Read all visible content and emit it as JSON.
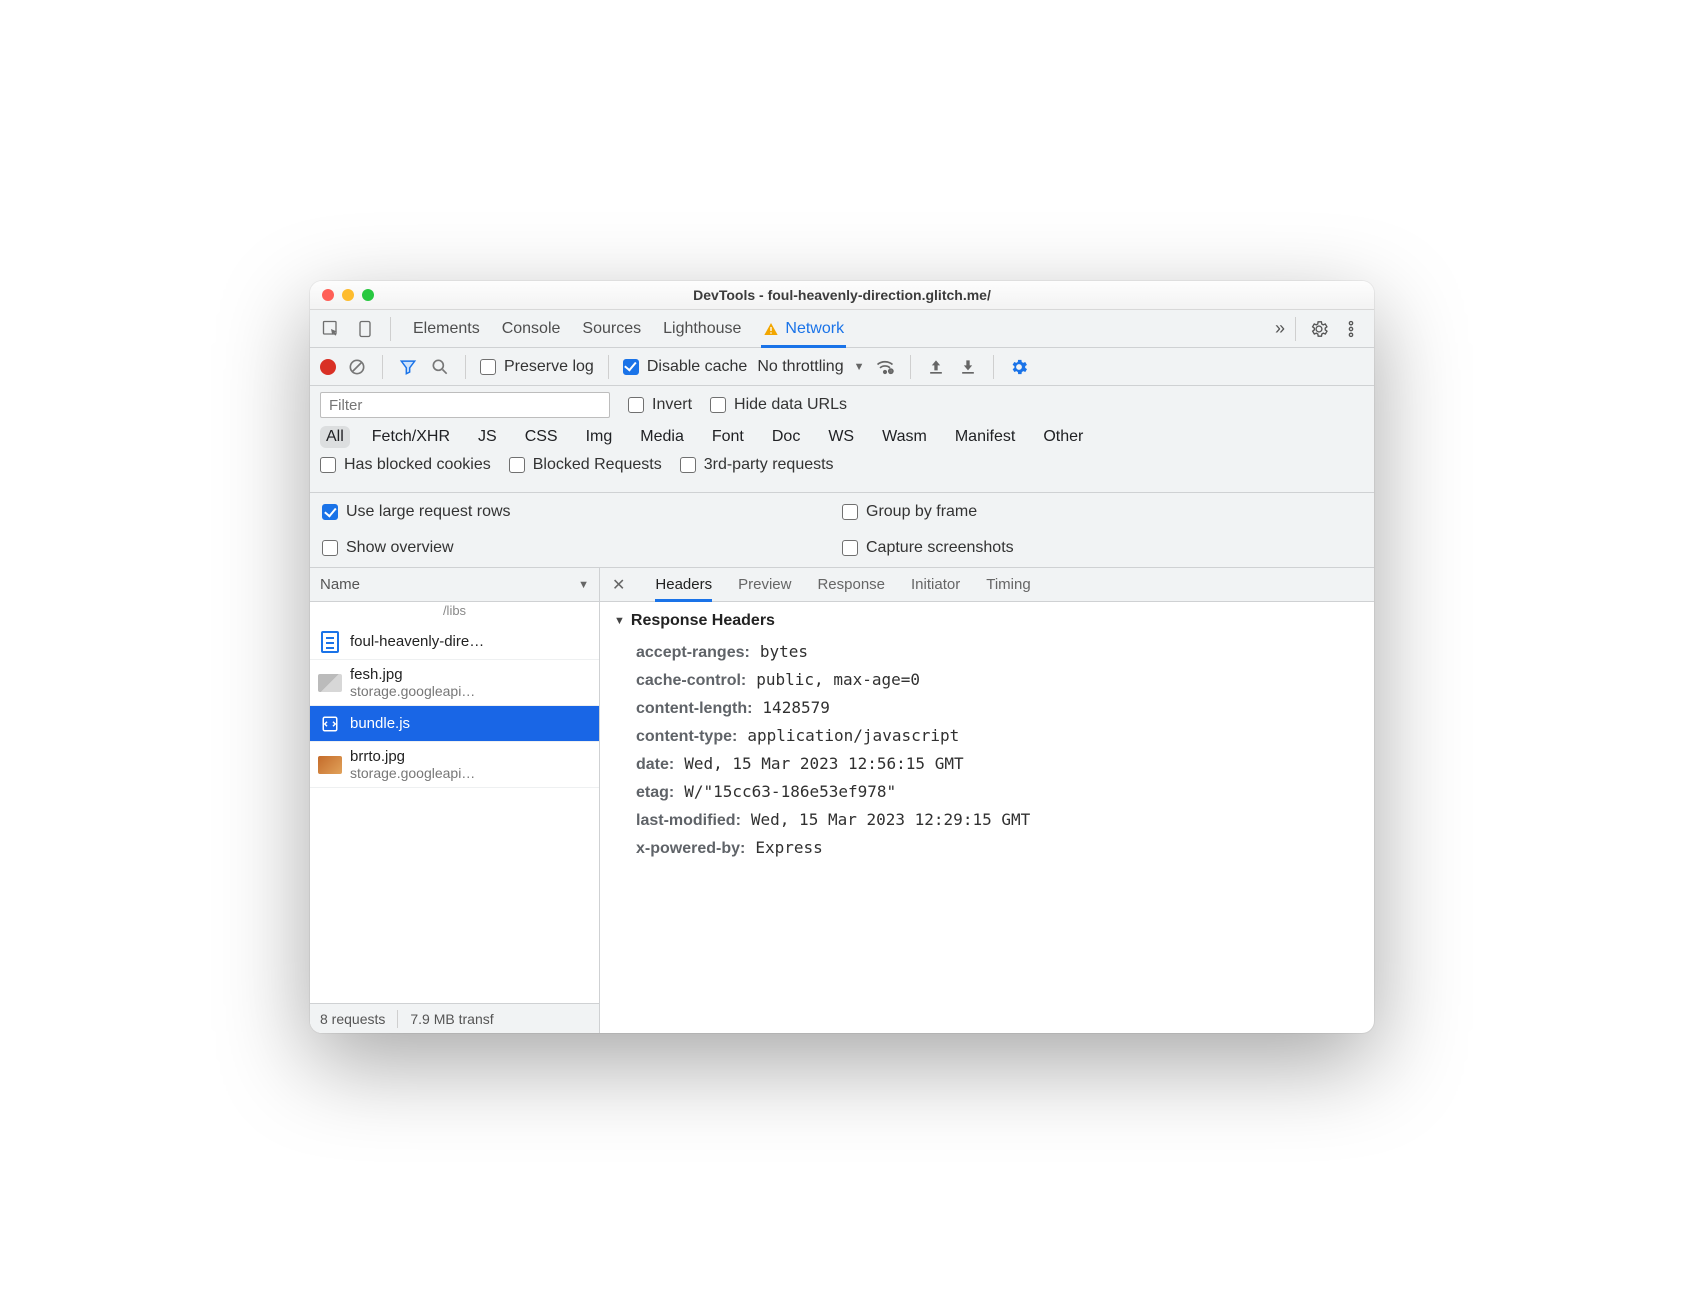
{
  "window": {
    "title": "DevTools - foul-heavenly-direction.glitch.me/"
  },
  "tabs": {
    "items": [
      "Elements",
      "Console",
      "Sources",
      "Lighthouse",
      "Network"
    ],
    "active": "Network",
    "more": "»"
  },
  "toolbar": {
    "preserve_log": "Preserve log",
    "disable_cache": "Disable cache",
    "throttling": "No throttling"
  },
  "filter": {
    "placeholder": "Filter",
    "invert": "Invert",
    "hide_data": "Hide data URLs",
    "types": [
      "All",
      "Fetch/XHR",
      "JS",
      "CSS",
      "Img",
      "Media",
      "Font",
      "Doc",
      "WS",
      "Wasm",
      "Manifest",
      "Other"
    ],
    "active_type": "All",
    "blocked_cookies": "Has blocked cookies",
    "blocked_requests": "Blocked Requests",
    "third_party": "3rd-party requests"
  },
  "settings": {
    "large_rows": "Use large request rows",
    "group_frame": "Group by frame",
    "show_overview": "Show overview",
    "capture": "Capture screenshots"
  },
  "list": {
    "header": "Name",
    "trunc": "/libs",
    "rows": [
      {
        "title": "foul-heavenly-dire…",
        "sub": "",
        "kind": "doc"
      },
      {
        "title": "fesh.jpg",
        "sub": "storage.googleapi…",
        "kind": "img"
      },
      {
        "title": "bundle.js",
        "sub": "",
        "kind": "js",
        "selected": true
      },
      {
        "title": "brrto.jpg",
        "sub": "storage.googleapi…",
        "kind": "img2"
      }
    ]
  },
  "status": {
    "requests": "8 requests",
    "transfer": "7.9 MB transf"
  },
  "detail": {
    "tabs": [
      "Headers",
      "Preview",
      "Response",
      "Initiator",
      "Timing"
    ],
    "active": "Headers",
    "section": "Response Headers",
    "headers": [
      {
        "k": "accept-ranges:",
        "v": "bytes"
      },
      {
        "k": "cache-control:",
        "v": "public, max-age=0"
      },
      {
        "k": "content-length:",
        "v": "1428579"
      },
      {
        "k": "content-type:",
        "v": "application/javascript"
      },
      {
        "k": "date:",
        "v": "Wed, 15 Mar 2023 12:56:15 GMT"
      },
      {
        "k": "etag:",
        "v": "W/\"15cc63-186e53ef978\""
      },
      {
        "k": "last-modified:",
        "v": "Wed, 15 Mar 2023 12:29:15 GMT"
      },
      {
        "k": "x-powered-by:",
        "v": "Express"
      }
    ]
  }
}
